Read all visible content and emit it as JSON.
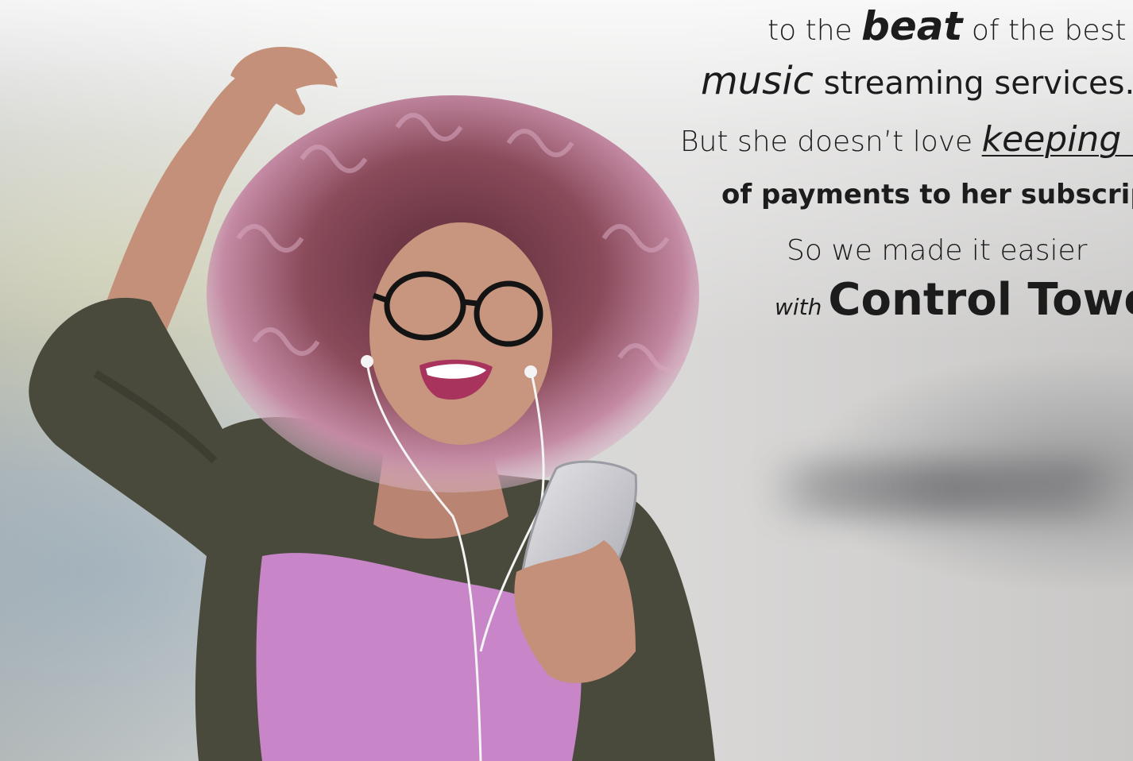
{
  "headline": {
    "line1": {
      "pre": "to the ",
      "em": "beat",
      "post": " of the best"
    },
    "line2": {
      "em": "music",
      "post": " streaming services."
    },
    "line3": {
      "pre": "But she doesn’t love ",
      "em": "keeping t"
    },
    "line4": {
      "text": "of payments to her subscrip"
    },
    "line5": {
      "text": "So we made it easier"
    },
    "line6": {
      "small": "with",
      "big": "Control Towe"
    }
  },
  "colors": {
    "text": "#1c1c1c",
    "shirt": "#c886c8",
    "jacket": "#4a4a3c",
    "hair": "#8a4a5a",
    "skin": "#c08f78",
    "phone": "#c9c9cf"
  }
}
